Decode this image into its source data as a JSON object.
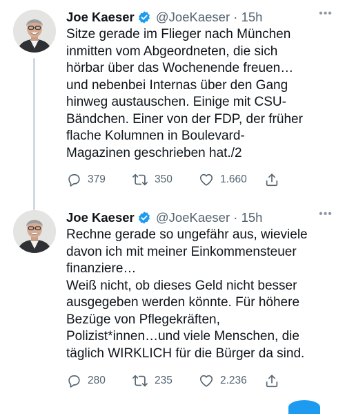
{
  "tweets": [
    {
      "name": "Joe Kaeser",
      "handle": "@JoeKaeser",
      "separator": "·",
      "time": "15h",
      "text": "Sitze gerade im Flieger nach München\ninmitten vom Abgeordneten, die sich\nhörbar über das Wochenende freuen…\nund nebenbei Internas über den Gang\nhinweg austauschen. Einige mit CSU-\nBändchen. Einer von der FDP, der früher\nflache Kolumnen in Boulevard-\nMagazinen geschrieben hat./2",
      "replies": "379",
      "retweets": "350",
      "likes": "1.660"
    },
    {
      "name": "Joe Kaeser",
      "handle": "@JoeKaeser",
      "separator": "·",
      "time": "15h",
      "text": "Rechne gerade so ungefähr aus, wieviele\ndavon ich mit meiner Einkommensteuer\nfinanziere…\nWeiß nicht, ob dieses Geld nicht besser\nausgegeben werden könnte. Für höhere\nBezüge von Pflegekräften,\nPolizist*innen…und viele Menschen, die\ntäglich WIRKLICH für die Bürger da sind.",
      "replies": "280",
      "retweets": "235",
      "likes": "2.236"
    }
  ],
  "icons": {
    "verified": "verified-badge-icon",
    "more": "more-dots-icon",
    "reply": "reply-bubble-icon",
    "retweet": "retweet-icon",
    "like": "heart-icon",
    "share": "share-icon"
  },
  "colors": {
    "text": "#0f1419",
    "secondary": "#536471",
    "verified": "#1d9bf0",
    "thread_line": "#cfd9de"
  }
}
